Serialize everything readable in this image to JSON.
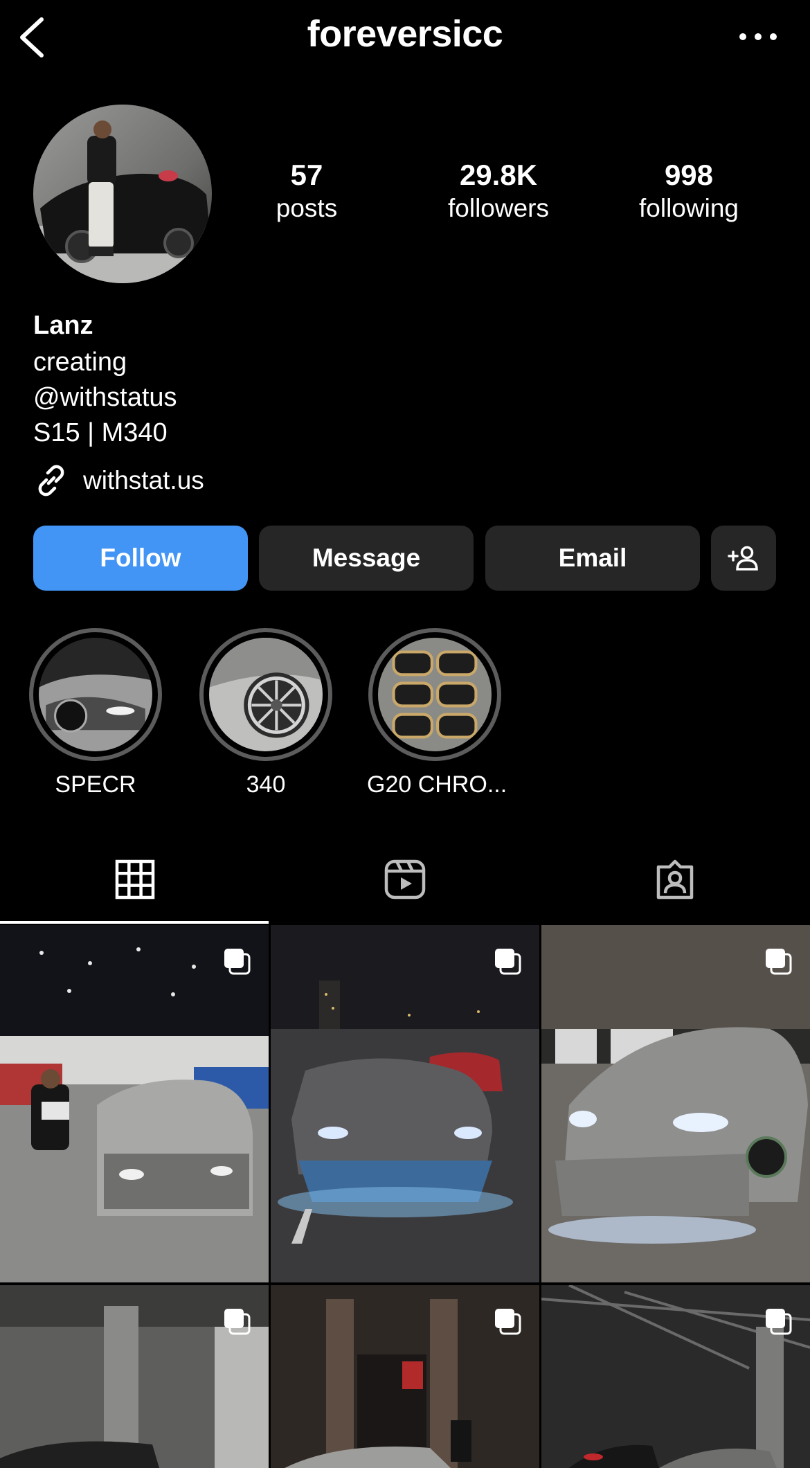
{
  "header": {
    "username": "foreversicc"
  },
  "stats": {
    "posts": {
      "value": "57",
      "label": "posts"
    },
    "followers": {
      "value": "29.8K",
      "label": "followers"
    },
    "following": {
      "value": "998",
      "label": "following"
    }
  },
  "bio": {
    "name": "Lanz",
    "lines": [
      "creating",
      "@withstatus",
      "S15 | M340"
    ],
    "link": "withstat.us"
  },
  "actions": {
    "follow": "Follow",
    "message": "Message",
    "email": "Email"
  },
  "highlights": [
    {
      "label": "SPECR"
    },
    {
      "label": "340"
    },
    {
      "label": "G20 CHRO..."
    }
  ],
  "tabs": [
    "posts-grid",
    "reels",
    "tagged"
  ],
  "colors": {
    "background": "#000000",
    "follow_button": "#4294f5",
    "secondary_button": "#262626",
    "highlight_ring": "#5c5c5c"
  }
}
